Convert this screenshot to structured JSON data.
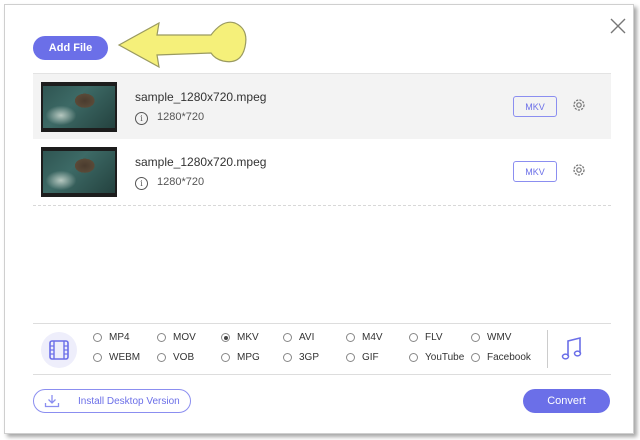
{
  "toolbar": {
    "add_label": "Add File"
  },
  "files": [
    {
      "name": "sample_1280x720.mpeg",
      "resolution": "1280*720",
      "format": "MKV"
    },
    {
      "name": "sample_1280x720.mpeg",
      "resolution": "1280*720",
      "format": "MKV"
    }
  ],
  "formats": {
    "row1": [
      "MP4",
      "MOV",
      "MKV",
      "AVI",
      "M4V",
      "FLV",
      "WMV"
    ],
    "row2": [
      "WEBM",
      "VOB",
      "MPG",
      "3GP",
      "GIF",
      "YouTube",
      "Facebook"
    ],
    "selected": "MKV"
  },
  "footer": {
    "install_label": "Install Desktop Version",
    "convert_label": "Convert"
  },
  "colors": {
    "accent": "#6b6fe8",
    "arrow": "#f5f07a"
  },
  "icons": [
    "close-icon",
    "info-icon",
    "gear-icon",
    "film-icon",
    "music-note-icon",
    "download-icon",
    "pointer-arrow"
  ]
}
